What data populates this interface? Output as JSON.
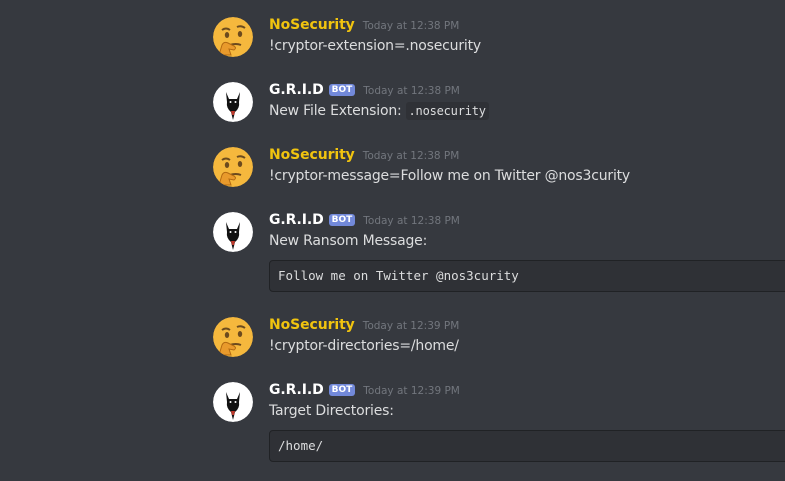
{
  "colors": {
    "background": "#36393f",
    "nosecurity_name": "#f1c40f",
    "bot_name": "#ffffff",
    "bot_tag": "#7289da",
    "message_text": "#dcddde",
    "timestamp": "#72767d",
    "code_background": "#2f3136"
  },
  "messages": [
    {
      "author": "NoSecurity",
      "avatar_icon": "thinking-face-emoji-icon",
      "timestamp": "Today at 12:38 PM",
      "content": "!cryptor-extension=.nosecurity"
    },
    {
      "author": "G.R.I.D",
      "bot_tag": "BOT",
      "avatar_icon": "black-cat-avatar-icon",
      "timestamp": "Today at 12:38 PM",
      "content": "New File Extension:",
      "inline_code": ".nosecurity"
    },
    {
      "author": "NoSecurity",
      "avatar_icon": "thinking-face-emoji-icon",
      "timestamp": "Today at 12:38 PM",
      "content": "!cryptor-message=Follow me on Twitter @nos3curity"
    },
    {
      "author": "G.R.I.D",
      "bot_tag": "BOT",
      "avatar_icon": "black-cat-avatar-icon",
      "timestamp": "Today at 12:38 PM",
      "content": "New Ransom Message:",
      "code_block": "Follow me on Twitter @nos3curity"
    },
    {
      "author": "NoSecurity",
      "avatar_icon": "thinking-face-emoji-icon",
      "timestamp": "Today at 12:39 PM",
      "content": "!cryptor-directories=/home/"
    },
    {
      "author": "G.R.I.D",
      "bot_tag": "BOT",
      "avatar_icon": "black-cat-avatar-icon",
      "timestamp": "Today at 12:39 PM",
      "content": "Target Directories:",
      "code_block": "/home/"
    }
  ]
}
